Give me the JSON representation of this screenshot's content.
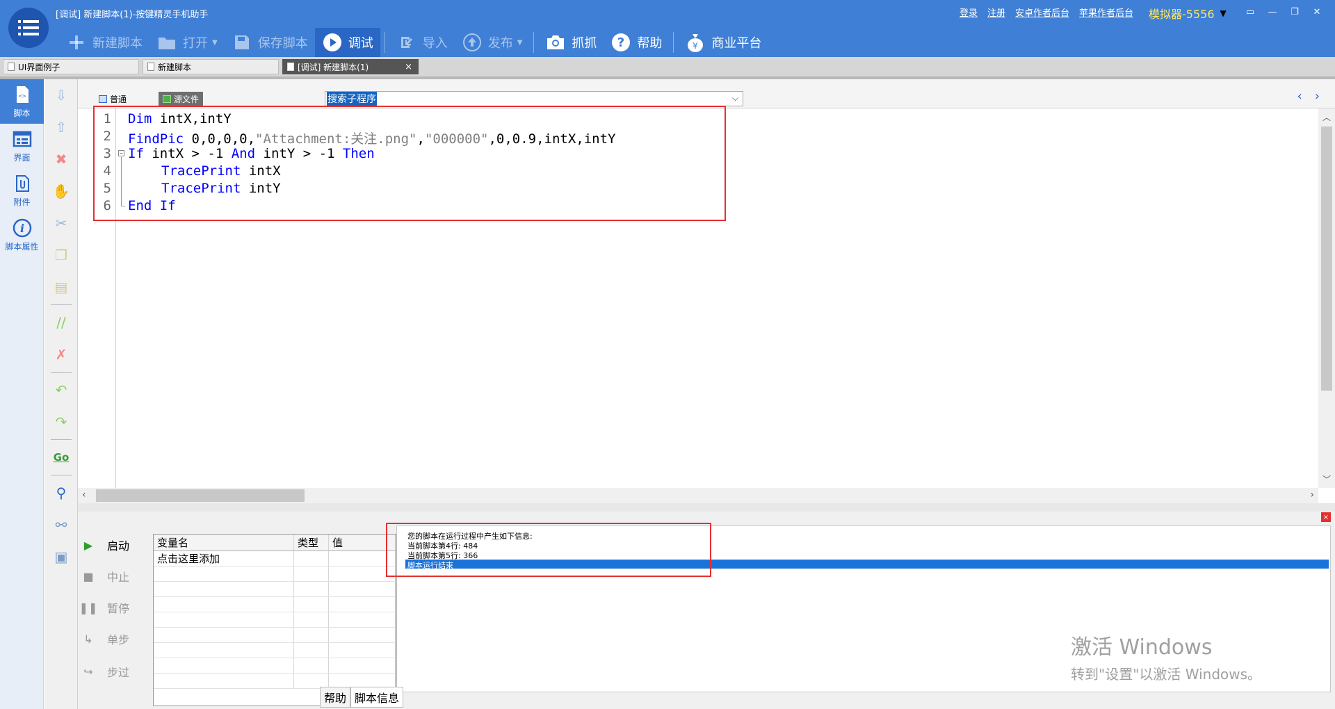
{
  "window": {
    "title": "[调试] 新建脚本(1)-按键精灵手机助手"
  },
  "toolbar": {
    "new_script": "新建脚本",
    "open": "打开",
    "save_script": "保存脚本",
    "debug": "调试",
    "import": "导入",
    "publish": "发布",
    "capture": "抓抓",
    "help": "帮助",
    "business": "商业平台"
  },
  "top_links": [
    "登录",
    "注册",
    "安卓作者后台",
    "苹果作者后台"
  ],
  "emulator": "模拟器-5556",
  "doc_tabs": [
    {
      "label": "UI界面例子"
    },
    {
      "label": "新建脚本"
    },
    {
      "label": "[调试] 新建脚本(1)",
      "close": "×"
    }
  ],
  "sidebar": {
    "items": [
      {
        "label": "脚本",
        "icon": "script-icon"
      },
      {
        "label": "界面",
        "icon": "ui-icon"
      },
      {
        "label": "附件",
        "icon": "attachment-icon"
      },
      {
        "label": "脚本属性",
        "icon": "info-icon"
      }
    ]
  },
  "editor": {
    "mode_normal": "普通",
    "mode_source": "源文件",
    "sub_search": "搜索子程序",
    "line_numbers": [
      "1",
      "2",
      "3",
      "4",
      "5",
      "6"
    ],
    "code": {
      "l1_kw": "Dim",
      "l1_rest": " intX,intY",
      "l2_kw": "FindPic",
      "l2_a": " 0,0,0,0,",
      "l2_s1": "\"Attachment:关注.png\"",
      "l2_b": ",",
      "l2_s2": "\"000000\"",
      "l2_c": ",0,0.9,intX,intY",
      "l3_if": "If",
      "l3_a": " intX > -1 ",
      "l3_and": "And",
      "l3_b": " intY > -1 ",
      "l3_then": "Then",
      "l4_kw": "TracePrint",
      "l4_rest": " intX",
      "l5_kw": "TracePrint",
      "l5_rest": " intY",
      "l6_kw": "End If"
    }
  },
  "debug_controls": {
    "start": "启动",
    "stop": "中止",
    "pause": "暂停",
    "step": "单步",
    "step_over": "步过"
  },
  "variables": {
    "columns": [
      "变量名",
      "类型",
      "值"
    ],
    "add_hint": "点击这里添加"
  },
  "output": {
    "lines": [
      "您的脚本在运行过程中产生如下信息:",
      "当前脚本第4行: 484",
      "当前脚本第5行: 366"
    ],
    "selected": "脚本运行结束",
    "tabs": [
      "帮助",
      "脚本信息"
    ]
  },
  "watermark": {
    "line1": "激活 Windows",
    "line2": "转到\"设置\"以激活 Windows。"
  },
  "colors": {
    "titlebar": "#3f7fd6",
    "keyword": "#0000ff",
    "string": "#808080",
    "highlight_box": "#e53030"
  }
}
